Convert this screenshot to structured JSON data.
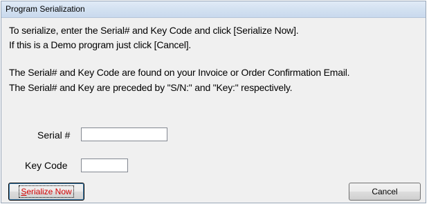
{
  "window": {
    "title": "Program Serialization"
  },
  "message": {
    "line1": "To serialize, enter the Serial# and Key Code and click [Serialize Now].",
    "line2": "If this is a Demo program just click [Cancel].",
    "line3": "The Serial# and Key Code are found on your Invoice or Order Confirmation Email.",
    "line4": "The Serial# and Key are preceded by \"S/N:\" and \"Key:\" respectively."
  },
  "form": {
    "serial_label": "Serial #",
    "serial_value": "",
    "keycode_label": "Key Code",
    "keycode_value": ""
  },
  "buttons": {
    "serialize_accel": "S",
    "serialize_rest": "erialize Now",
    "serialize_color": "#d40000",
    "cancel_label": "Cancel"
  }
}
